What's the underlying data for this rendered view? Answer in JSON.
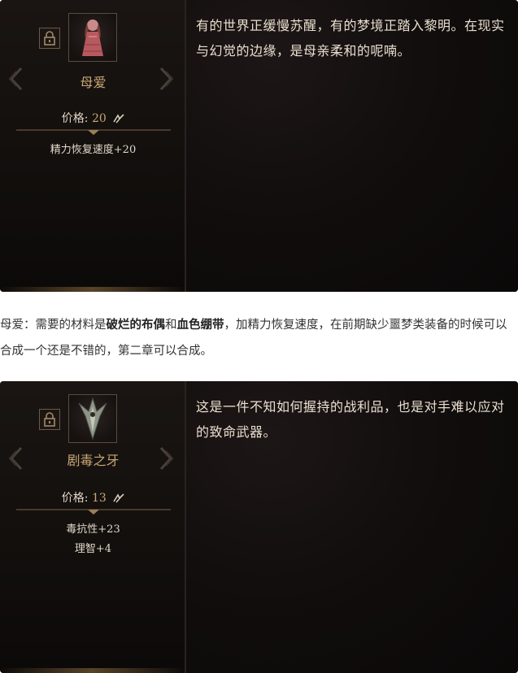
{
  "cards": [
    {
      "name": "母爱",
      "price_label": "价格:",
      "price_value": "20",
      "stats": [
        "精力恢复速度+20"
      ],
      "description": "有的世界正缓慢苏醒，有的梦境正踏入黎明。在现实与幻觉的边缘，是母亲柔和的呢喃。",
      "icon": "doll-icon"
    },
    {
      "name": "剧毒之牙",
      "price_label": "价格:",
      "price_value": "13",
      "stats": [
        "毒抗性+23",
        "理智+4"
      ],
      "description": "这是一件不知如何握持的战利品，也是对手难以应对的致命武器。",
      "icon": "fang-icon"
    }
  ],
  "article": {
    "prefix": "母爱：需要的材料是",
    "material1": "破烂的布偶",
    "connector": "和",
    "material2": "血色绷带",
    "suffix": "，加精力恢复速度，在前期缺少噩梦类装备的时候可以合成一个还是不错的，第二章可以合成。"
  },
  "colors": {
    "card_bg": "#0e0b0b",
    "gold_text": "#c9a774",
    "body_text": "#eadfcf"
  }
}
